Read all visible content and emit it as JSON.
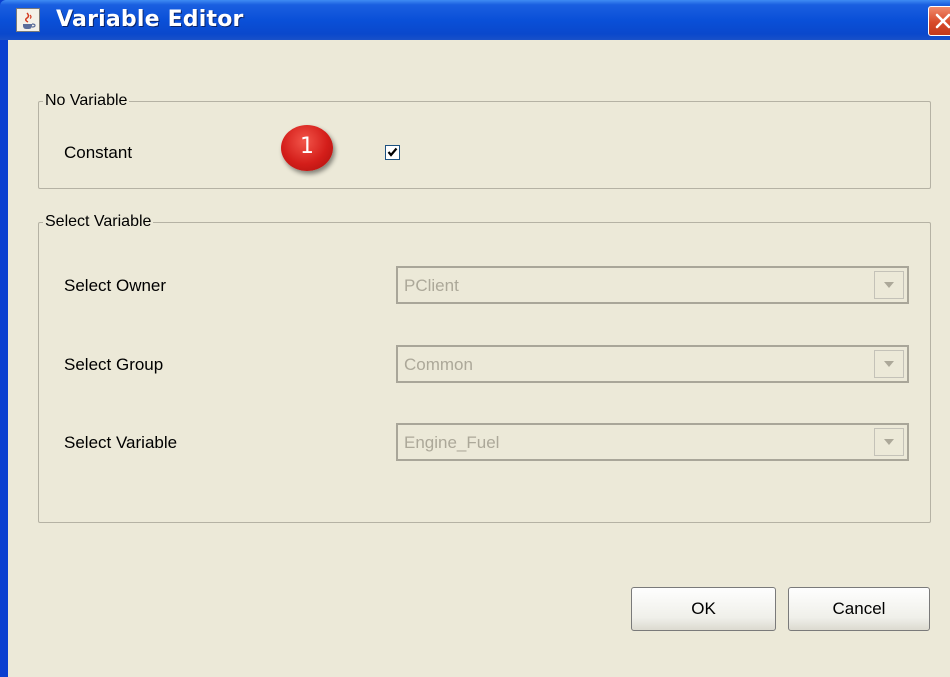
{
  "window": {
    "title": "Variable Editor",
    "app_icon": "java-cup-icon",
    "close_icon": "close-icon"
  },
  "no_variable_group": {
    "legend": "No Variable",
    "constant_label": "Constant",
    "constant_checked": true,
    "annotation_badge": "1"
  },
  "select_variable_group": {
    "legend": "Select Variable",
    "owner": {
      "label": "Select Owner",
      "value": "PClient",
      "enabled": false
    },
    "group": {
      "label": "Select Group",
      "value": "Common",
      "enabled": false
    },
    "variable": {
      "label": "Select Variable",
      "value": "Engine_Fuel",
      "enabled": false
    }
  },
  "buttons": {
    "ok": "OK",
    "cancel": "Cancel"
  },
  "colors": {
    "titlebar": "#0a50d8",
    "face": "#ece9d8",
    "badge": "#d41e1a",
    "disabled_text": "#aca899"
  }
}
